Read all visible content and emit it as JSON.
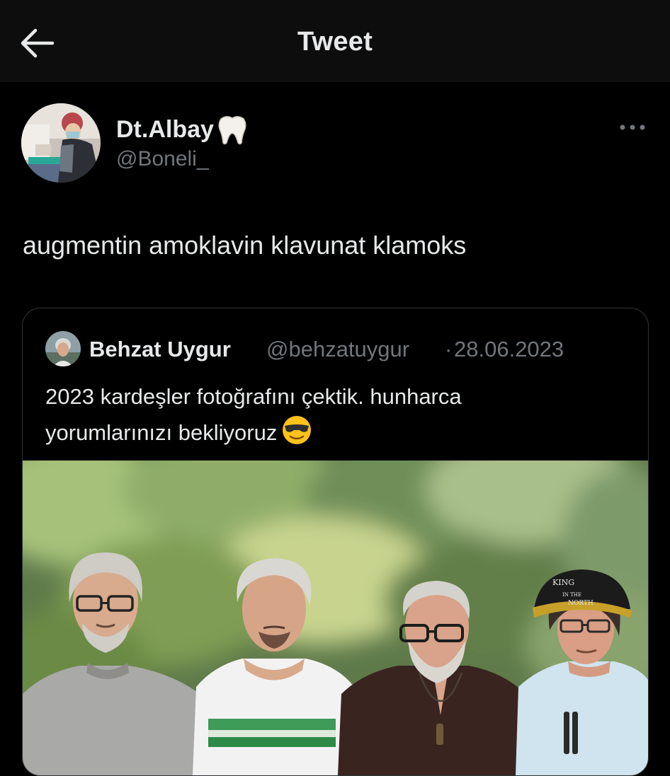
{
  "header": {
    "title": "Tweet",
    "back_icon": "arrow-left-icon"
  },
  "tweet": {
    "author_name": "Dt.Albay",
    "author_emoji": "tooth",
    "author_handle": "@Boneli_",
    "more_icon": "more-horizontal-icon",
    "text": "augmentin amoklavin klavunat klamoks"
  },
  "quoted_tweet": {
    "author_name": "Behzat Uygur",
    "author_handle": "@behzatuygur",
    "separator": "·",
    "date": "28.06.2023",
    "text_line1": "2023  kardeşler fotoğrafını çektik. hunharca",
    "text_line2": "yorumlarınızı bekliyoruz",
    "emoji": "smiling-face-with-sunglasses",
    "hat_text_1": "KING",
    "hat_text_2": "IN THE",
    "hat_text_3": "NORTH"
  },
  "colors": {
    "background": "#000000",
    "header_background": "#0d0d0d",
    "primary_text": "#e7e9ea",
    "secondary_text": "#71767b",
    "border": "#2f3336"
  }
}
